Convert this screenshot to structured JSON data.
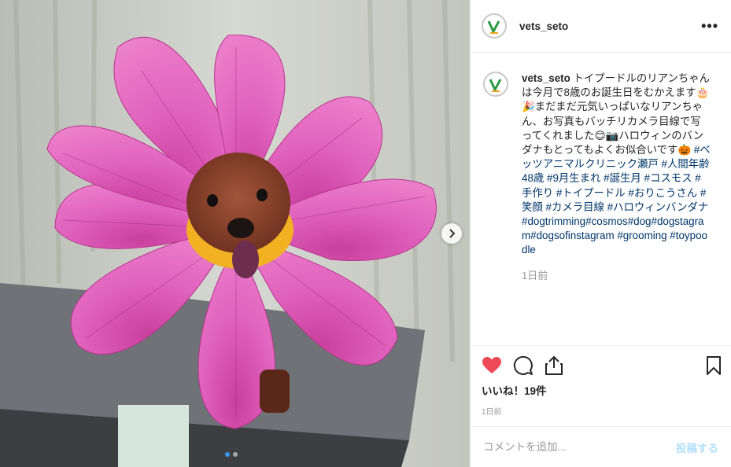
{
  "post": {
    "username": "vets_seto",
    "more_label": "•••",
    "caption_text": "トイプードルのリアンちゃんは今月で8歳のお誕生日をむかえます🎂🎉まだまだ元気いっぱいなリアンちゃん、お写真もバッチリカメラ目線で写ってくれました😊📷ハロウィンのバンダナもとってもよくお似合いです🎃",
    "hashtags_jp": "#ベッツアニマルクリニック瀬戸 #人間年齢48歳 #9月生まれ #誕生月 #コスモス #手作り #トイプードル #おりこうさん #笑顔 #カメラ目線 #ハロウィンバンダナ",
    "hashtags_en": "#dogtrimming#cosmos#dog#dogstagram#dogsofinstagram #grooming #toypoodle",
    "relative_time": "1日前",
    "likes_text": "いいね！19件",
    "date_small": "1日前"
  },
  "comment_box": {
    "placeholder": "コメントを追加...",
    "post_label": "投稿する"
  },
  "icons": {
    "like": "heart-filled-icon",
    "comment": "comment-icon",
    "share": "share-icon",
    "save": "bookmark-icon",
    "next": "chevron-right-icon"
  },
  "colors": {
    "heart": "#ed4956",
    "hashtag": "#003569",
    "post_button": "#b2dffc",
    "carousel_active_dot": "#3897f0",
    "flower": "#e05cb8"
  }
}
